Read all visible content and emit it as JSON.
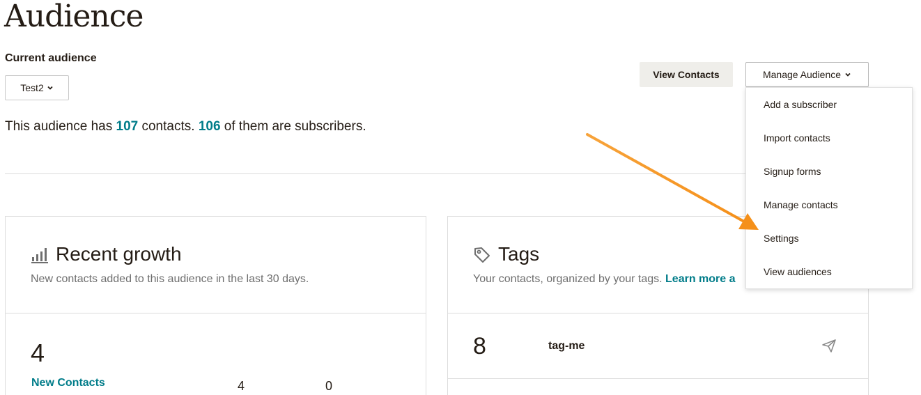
{
  "page": {
    "title": "Audience"
  },
  "audience": {
    "current_label": "Current audience",
    "selected": "Test2",
    "summary_prefix": "This audience has ",
    "contacts_count": "107",
    "summary_mid": " contacts. ",
    "subscribers_count": "106",
    "summary_suffix": " of them are subscribers."
  },
  "actions": {
    "view_contacts": "View Contacts",
    "manage_audience": "Manage Audience"
  },
  "manage_menu": {
    "items": [
      "Add a subscriber",
      "Import contacts",
      "Signup forms",
      "Manage contacts",
      "Settings",
      "View audiences"
    ]
  },
  "growth": {
    "title": "Recent growth",
    "subtitle": "New contacts added to this audience in the last 30 days.",
    "count": "4",
    "link": "New Contacts",
    "value_1": "4",
    "value_2": "0"
  },
  "tags": {
    "title": "Tags",
    "subtitle": "Your contacts, organized by your tags.",
    "learn_more": "Learn more a",
    "rows": [
      {
        "count": "8",
        "name": "tag-me"
      }
    ]
  },
  "colors": {
    "accent": "#007c89",
    "annotation_arrow": "#f7941d"
  }
}
